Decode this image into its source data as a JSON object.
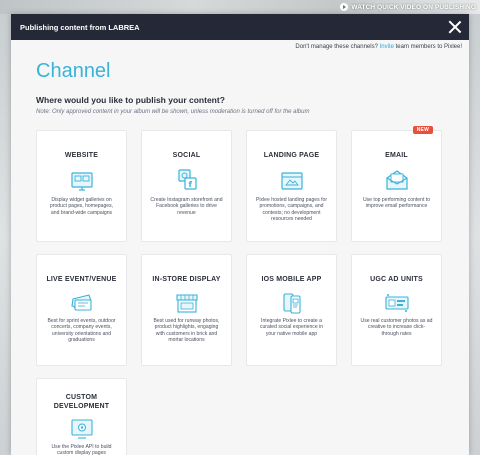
{
  "background": {
    "watch_link": "WATCH QUICK VIDEO ON PUBLISHING"
  },
  "modal": {
    "title": "Publishing content from LABREA",
    "manage_prefix": "Don't manage these channels?",
    "invite_link": "Invite",
    "manage_suffix": "team members to Pixlee!",
    "heading": "Channel",
    "question": "Where would you like to publish your content?",
    "note": "Note: Only approved content in your album will be shown, unless moderation is turned off for the album"
  },
  "colors": {
    "accent": "#39b3d9",
    "header_bg": "#252836",
    "badge": "#e6503c"
  },
  "channels": [
    {
      "title": "WEBSITE",
      "icon": "website-icon",
      "description": "Display widget galleries on product pages, homepages, and brand-wide campaigns"
    },
    {
      "title": "SOCIAL",
      "icon": "social-icon",
      "description": "Create Instagram storefront and Facebook galleries to drive revenue"
    },
    {
      "title": "LANDING PAGE",
      "icon": "landing-page-icon",
      "description": "Pixlee hosted landing pages for promotions, campaigns, and contests; no development resources needed"
    },
    {
      "title": "EMAIL",
      "icon": "email-icon",
      "description": "Use top performing content to improve email performance",
      "badge": "NEW"
    },
    {
      "title": "LIVE EVENT/VENUE",
      "icon": "ticket-icon",
      "description": "Best for sprint events, outdoor concerts, company events, university orientations and graduations"
    },
    {
      "title": "IN-STORE DISPLAY",
      "icon": "storefront-icon",
      "description": "Best used for runway photos, product highlights, engaging with customers in brick and mortar locations"
    },
    {
      "title": "IOS MOBILE APP",
      "icon": "mobile-app-icon",
      "description": "Integrate Pixlee to create a curated social experience in your native mobile app"
    },
    {
      "title": "UGC AD UNITS",
      "icon": "ad-units-icon",
      "description": "Use real customer photos as ad creative to increase click-through rates"
    },
    {
      "title": "CUSTOM DEVELOPMENT",
      "title_lines": [
        "CUSTOM",
        "DEVELOPMENT"
      ],
      "icon": "custom-development-icon",
      "description": "Use the Pixlee API to build custom display pages"
    }
  ]
}
